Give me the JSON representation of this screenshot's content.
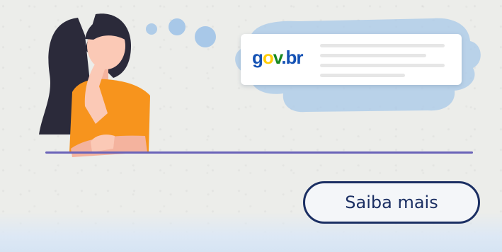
{
  "banner": {
    "logo": {
      "part1": "g",
      "part2": "o",
      "part3": "v",
      "part4": ".br"
    },
    "cta_label": "Saiba mais"
  },
  "colors": {
    "background": "#ecedea",
    "cloud": "#a8c8e8",
    "divider": "#6a63b8",
    "button_border": "#1b2f63",
    "shirt": "#f7941d",
    "hair": "#2b2a3a",
    "skin": "#fbc9b6",
    "logo_blue": "#1351b4",
    "logo_yellow": "#ffcd07",
    "logo_green": "#168821"
  },
  "icons": [
    "woman-thinking-illustration",
    "thought-bubble-icon",
    "cloud-shape",
    "govbr-logo"
  ]
}
